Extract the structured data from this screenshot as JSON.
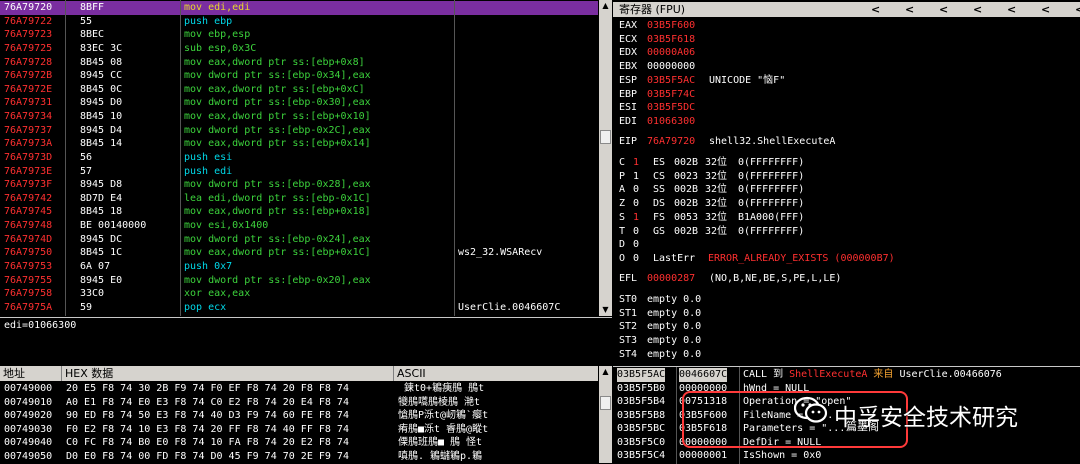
{
  "disasm": {
    "rows": [
      {
        "addr": "76A79720",
        "hex": "8BFF",
        "instr": "mov edi,edi",
        "comment": "",
        "selected": true,
        "cls": "yellow"
      },
      {
        "addr": "76A79722",
        "hex": "55",
        "instr": "push ebp",
        "comment": "",
        "cls": "cyan"
      },
      {
        "addr": "76A79723",
        "hex": "8BEC",
        "instr": "mov ebp,esp",
        "comment": "",
        "cls": "green"
      },
      {
        "addr": "76A79725",
        "hex": "83EC 3C",
        "instr": "sub esp,0x3C",
        "comment": "",
        "cls": "green"
      },
      {
        "addr": "76A79728",
        "hex": "8B45 08",
        "instr": "mov eax,dword ptr ss:[ebp+0x8]",
        "comment": "",
        "cls": "green"
      },
      {
        "addr": "76A7972B",
        "hex": "8945 CC",
        "instr": "mov dword ptr ss:[ebp-0x34],eax",
        "comment": "",
        "cls": "green"
      },
      {
        "addr": "76A7972E",
        "hex": "8B45 0C",
        "instr": "mov eax,dword ptr ss:[ebp+0xC]",
        "comment": "",
        "cls": "green"
      },
      {
        "addr": "76A79731",
        "hex": "8945 D0",
        "instr": "mov dword ptr ss:[ebp-0x30],eax",
        "comment": "",
        "cls": "green"
      },
      {
        "addr": "76A79734",
        "hex": "8B45 10",
        "instr": "mov eax,dword ptr ss:[ebp+0x10]",
        "comment": "",
        "cls": "green"
      },
      {
        "addr": "76A79737",
        "hex": "8945 D4",
        "instr": "mov dword ptr ss:[ebp-0x2C],eax",
        "comment": "",
        "cls": "green"
      },
      {
        "addr": "76A7973A",
        "hex": "8B45 14",
        "instr": "mov eax,dword ptr ss:[ebp+0x14]",
        "comment": "",
        "cls": "green"
      },
      {
        "addr": "76A7973D",
        "hex": "56",
        "instr": "push esi",
        "comment": "",
        "cls": "cyan"
      },
      {
        "addr": "76A7973E",
        "hex": "57",
        "instr": "push edi",
        "comment": "",
        "cls": "cyan"
      },
      {
        "addr": "76A7973F",
        "hex": "8945 D8",
        "instr": "mov dword ptr ss:[ebp-0x28],eax",
        "comment": "",
        "cls": "green"
      },
      {
        "addr": "76A79742",
        "hex": "8D7D E4",
        "instr": "lea edi,dword ptr ss:[ebp-0x1C]",
        "comment": "",
        "cls": "green"
      },
      {
        "addr": "76A79745",
        "hex": "8B45 18",
        "instr": "mov eax,dword ptr ss:[ebp+0x18]",
        "comment": "",
        "cls": "green"
      },
      {
        "addr": "76A79748",
        "hex": "BE 00140000",
        "instr": "mov esi,0x1400",
        "comment": "",
        "cls": "green"
      },
      {
        "addr": "76A7974D",
        "hex": "8945 DC",
        "instr": "mov dword ptr ss:[ebp-0x24],eax",
        "comment": "",
        "cls": "green"
      },
      {
        "addr": "76A79750",
        "hex": "8B45 1C",
        "instr": "mov eax,dword ptr ss:[ebp+0x1C]",
        "comment": "ws2_32.WSARecv",
        "cls": "green"
      },
      {
        "addr": "76A79753",
        "hex": "6A 07",
        "instr": "push 0x7",
        "comment": "",
        "cls": "cyan"
      },
      {
        "addr": "76A79755",
        "hex": "8945 E0",
        "instr": "mov dword ptr ss:[ebp-0x20],eax",
        "comment": "",
        "cls": "green"
      },
      {
        "addr": "76A79758",
        "hex": "33C0",
        "instr": "xor eax,eax",
        "comment": "",
        "cls": "green"
      },
      {
        "addr": "76A7975A",
        "hex": "59",
        "instr": "pop ecx",
        "comment": "UserClie.0046607C",
        "cls": "cyan"
      }
    ],
    "info_line": "edi=01066300"
  },
  "registers": {
    "title": "寄存器 (FPU)",
    "nav_arrows": [
      "<",
      "<",
      "<",
      "<",
      "<",
      "<",
      "<"
    ],
    "gp": [
      {
        "name": "EAX",
        "value": "03B5F600",
        "note": "",
        "changed": true
      },
      {
        "name": "ECX",
        "value": "03B5F618",
        "note": "",
        "changed": true
      },
      {
        "name": "EDX",
        "value": "00000A06",
        "note": "",
        "changed": true
      },
      {
        "name": "EBX",
        "value": "00000000",
        "note": "",
        "changed": false
      },
      {
        "name": "ESP",
        "value": "03B5F5AC",
        "note": "UNICODE \"恼F\"",
        "changed": true
      },
      {
        "name": "EBP",
        "value": "03B5F74C",
        "note": "",
        "changed": true
      },
      {
        "name": "ESI",
        "value": "03B5F5DC",
        "note": "",
        "changed": true
      },
      {
        "name": "EDI",
        "value": "01066300",
        "note": "",
        "changed": true
      }
    ],
    "eip": {
      "name": "EIP",
      "value": "76A79720",
      "note": "shell32.ShellExecuteA"
    },
    "flags": [
      {
        "f": "C",
        "v": "1",
        "seg": "ES",
        "sel": "002B",
        "bits": "32位",
        "base": "0(FFFFFFFF)",
        "vchanged": true
      },
      {
        "f": "P",
        "v": "1",
        "seg": "CS",
        "sel": "0023",
        "bits": "32位",
        "base": "0(FFFFFFFF)",
        "vchanged": false
      },
      {
        "f": "A",
        "v": "0",
        "seg": "SS",
        "sel": "002B",
        "bits": "32位",
        "base": "0(FFFFFFFF)",
        "vchanged": false
      },
      {
        "f": "Z",
        "v": "0",
        "seg": "DS",
        "sel": "002B",
        "bits": "32位",
        "base": "0(FFFFFFFF)",
        "vchanged": false
      },
      {
        "f": "S",
        "v": "1",
        "seg": "FS",
        "sel": "0053",
        "bits": "32位",
        "base": "B1A000(FFF)",
        "vchanged": true
      },
      {
        "f": "T",
        "v": "0",
        "seg": "GS",
        "sel": "002B",
        "bits": "32位",
        "base": "0(FFFFFFFF)",
        "vchanged": false
      },
      {
        "f": "D",
        "v": "0",
        "seg": "",
        "sel": "",
        "bits": "",
        "base": "",
        "vchanged": false
      },
      {
        "f": "O",
        "v": "0",
        "seg": "LastErr",
        "sel": "",
        "bits": "",
        "base": "ERROR_ALREADY_EXISTS (000000B7)",
        "vchanged": false
      }
    ],
    "efl": {
      "name": "EFL",
      "value": "00000287",
      "note": "(NO,B,NE,BE,S,PE,L,LE)"
    },
    "st": [
      {
        "name": "ST0",
        "value": "empty 0.0"
      },
      {
        "name": "ST1",
        "value": "empty 0.0"
      },
      {
        "name": "ST2",
        "value": "empty 0.0"
      },
      {
        "name": "ST3",
        "value": "empty 0.0"
      },
      {
        "name": "ST4",
        "value": "empty 0.0"
      }
    ]
  },
  "dump": {
    "headers": {
      "addr": "地址",
      "hex": "HEX 数据",
      "ascii": "ASCII"
    },
    "rows": [
      {
        "addr": "00749000",
        "hex": "20 E5 F8 74 30 2B F9 74 F0 EF F8 74 20 F8 F8 74",
        "ascii": " 鍊t0+鵴痍鴅 鴅t"
      },
      {
        "addr": "00749010",
        "hex": "A0 E1 F8 74 E0 E3 F8 74 C0 E2 F8 74 20 E4 F8 74",
        "ascii": "犪鴅嚆鴅棱鴅 滟t"
      },
      {
        "addr": "00749020",
        "hex": "90 ED F8 74 50 E3 F8 74 40 D3 F9 74 60 FE F8 74",
        "ascii": "愴鴅P泺t@屻鵴`瘿t"
      },
      {
        "addr": "00749030",
        "hex": "F0 E2 F8 74 10 E3 F8 74 20 FF F8 74 40 FF F8 74",
        "ascii": "痏鴅■泺t 睿鴅@瞛t"
      },
      {
        "addr": "00749040",
        "hex": "C0 FC F8 74 B0 E0 F8 74 10 FA F8 74 20 E2 F8 74",
        "ascii": "傈鴅班鴅■ 鴅 怪t"
      },
      {
        "addr": "00749050",
        "hex": "D0 E0 F8 74 00 FD F8 74 D0 45 F9 74 70 2E F9 74",
        "ascii": "嗔鴅. 鵴蠩鵴p.鵴"
      }
    ]
  },
  "stack": {
    "rows": [
      {
        "addr": "03B5F5AC",
        "val": "0046607C",
        "desc": "CALL 到 ShellExecuteA 来自 UserClie.00466076",
        "top": true
      },
      {
        "addr": "03B5F5B0",
        "val": "00000000",
        "desc": "hWnd = NULL"
      },
      {
        "addr": "03B5F5B4",
        "val": "00751318",
        "desc": "Operation = \"open\""
      },
      {
        "addr": "03B5F5B8",
        "val": "03B5F600",
        "desc": "FileName = \"..."
      },
      {
        "addr": "03B5F5BC",
        "val": "03B5F618",
        "desc": "Parameters = \"..."
      },
      {
        "addr": "03B5F5C0",
        "val": "00000000",
        "desc": "DefDir = NULL"
      },
      {
        "addr": "03B5F5C4",
        "val": "00000001",
        "desc": "IsShown = 0x0"
      }
    ],
    "call_parts": {
      "pre": "CALL 到 ",
      "target": "ShellExecuteA",
      "mid": " 来自 ",
      "from": "UserClie.00466076"
    }
  },
  "watermark": {
    "text": "中孚安全技术研究",
    "subtext": "篇墨阁"
  },
  "colors": {
    "selection": "#7a2ea0",
    "changed": "#ff3030",
    "panel_bg": "#000000",
    "highlight_box": "#ff3a3a"
  }
}
